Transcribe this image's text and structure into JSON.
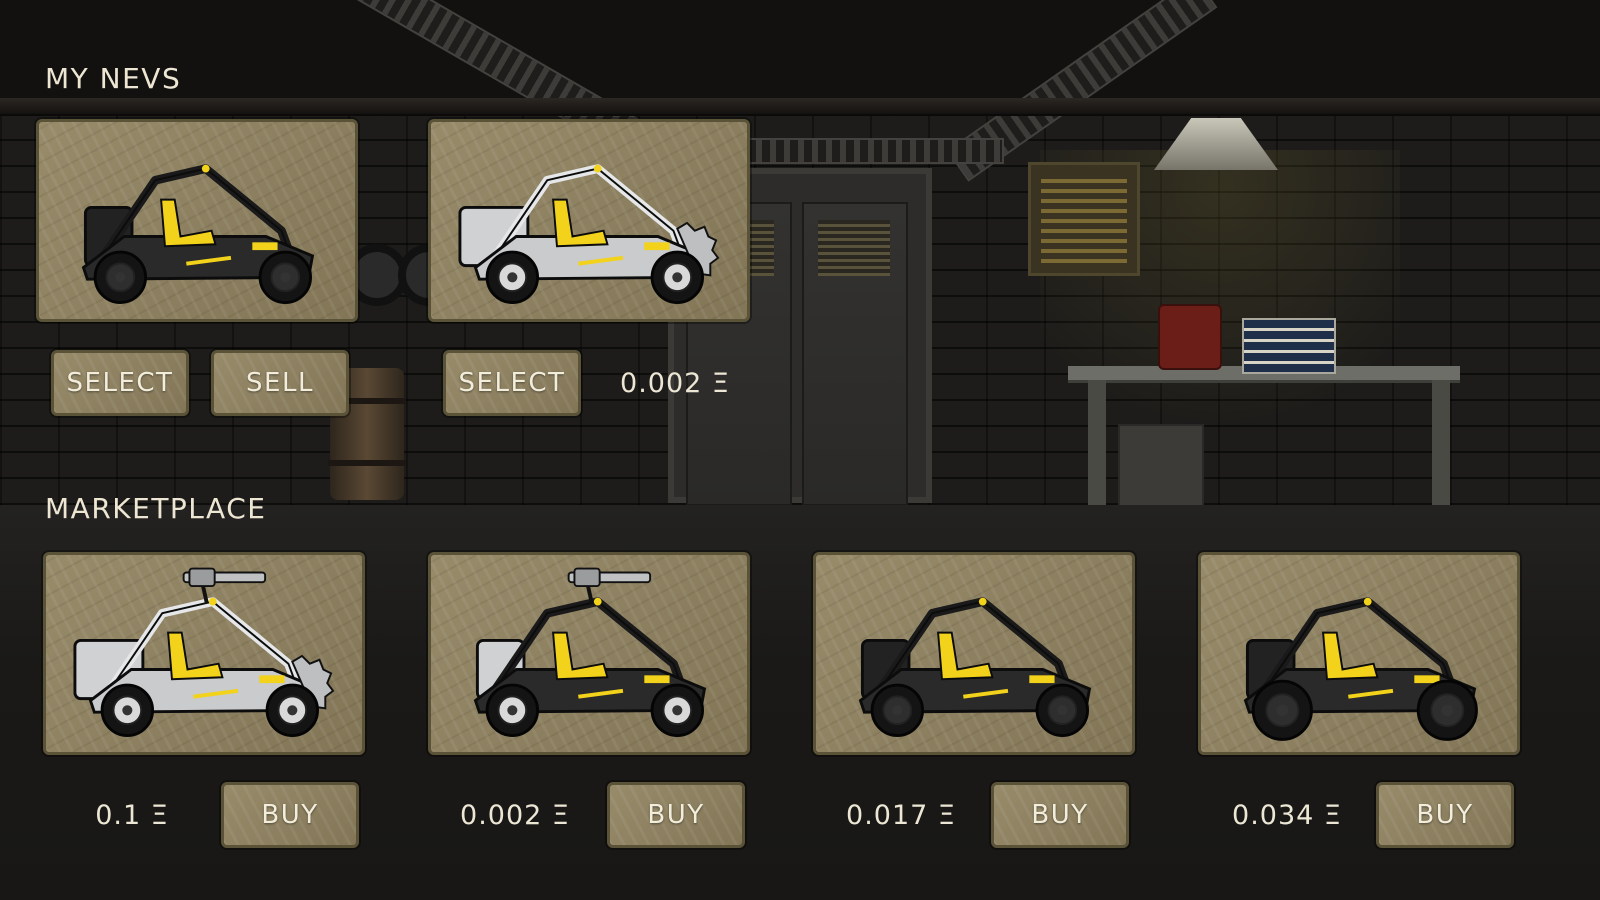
{
  "my_nevs": {
    "title": "MY NEVS",
    "items": [
      {
        "variant": "black-buggy",
        "select_label": "SELECT",
        "sell_label": "SELL"
      },
      {
        "variant": "silver-armored-buggy",
        "select_label": "SELECT",
        "price": "0.002 Ξ"
      }
    ]
  },
  "marketplace": {
    "title": "MARKETPLACE",
    "items": [
      {
        "variant": "silver-gunner-buggy",
        "price": "0.1 Ξ",
        "buy_label": "BUY"
      },
      {
        "variant": "hybrid-gunner-buggy",
        "price": "0.002 Ξ",
        "buy_label": "BUY"
      },
      {
        "variant": "black-buggy",
        "price": "0.017 Ξ",
        "buy_label": "BUY"
      },
      {
        "variant": "black-buggy-big-wheels",
        "price": "0.034 Ξ",
        "buy_label": "BUY"
      }
    ]
  },
  "colors": {
    "card_bg": "#8a7e5e",
    "card_border": "#5b5338",
    "text": "#ece6d4",
    "accent_yellow": "#f2d21a"
  }
}
